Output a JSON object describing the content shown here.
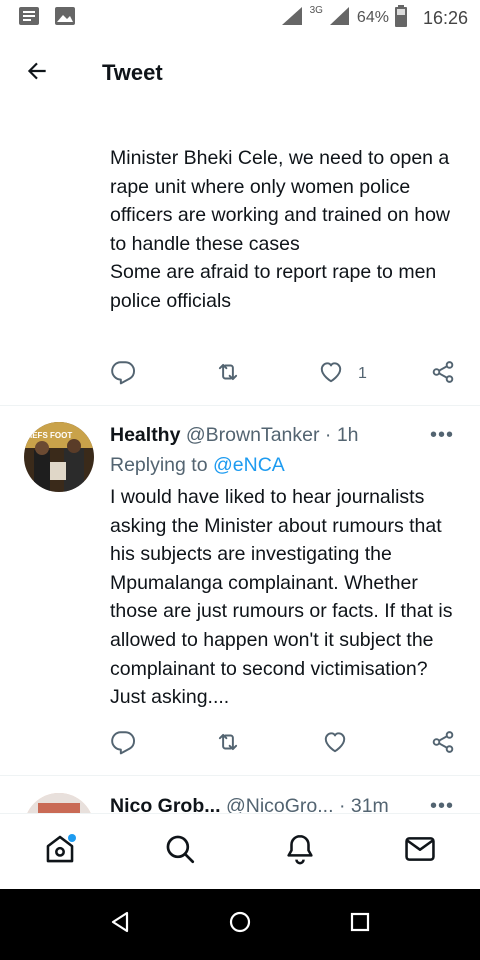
{
  "status_bar": {
    "network": "3G",
    "battery": "64%",
    "time": "16:26"
  },
  "header": {
    "title": "Tweet"
  },
  "tweet1": {
    "text": "Minister Bheki Cele, we need to open a rape unit where only women police officers are working and trained on how to handle these cases\nSome are afraid to report rape to men police officials",
    "like_count": "1"
  },
  "tweet2": {
    "name": "Healthy",
    "handle": "@BrownTanker",
    "sep": "·",
    "time": "1h",
    "replying_prefix": "Replying to",
    "replying_to": "@eNCA",
    "text": "I would have liked to hear journalists asking the Minister about rumours that his subjects are investigating the Mpumalanga complainant. Whether those are just rumours or facts. If that is allowed to happen won't it subject the complainant to second victimisation? Just asking....",
    "avatar_text": "IEFS FOOT"
  },
  "tweet3": {
    "name": "Nico Grob...",
    "handle": "@NicoGro...",
    "sep": "·",
    "time": "31m"
  },
  "more_label": "•••",
  "icons": {
    "back": "arrow-left-icon",
    "reply": "reply-icon",
    "retweet": "retweet-icon",
    "like": "heart-icon",
    "share": "share-icon",
    "home": "home-icon",
    "search": "search-icon",
    "notifications": "bell-icon",
    "messages": "mail-icon"
  },
  "colors": {
    "accent": "#1d9bf0",
    "text": "#0f1419",
    "secondary": "#536471"
  }
}
